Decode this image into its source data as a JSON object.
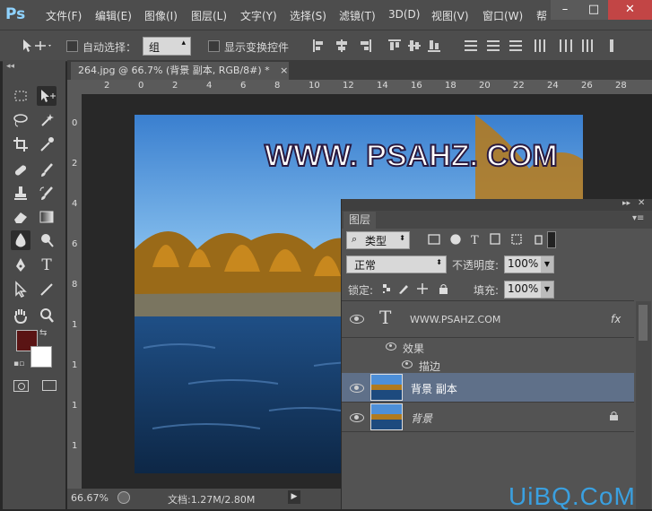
{
  "menubar": {
    "logo": "Ps",
    "items": [
      "文件(F)",
      "编辑(E)",
      "图像(I)",
      "图层(L)",
      "文字(Y)",
      "选择(S)",
      "滤镜(T)",
      "3D(D)",
      "视图(V)",
      "窗口(W)",
      "帮"
    ],
    "window_buttons": [
      "–",
      "□",
      "✕"
    ]
  },
  "options": {
    "auto_select_label": "自动选择：",
    "auto_select_value": "组",
    "show_transform_label": "显示变换控件"
  },
  "document": {
    "tab_title": "264.jpg @ 66.7% (背景 副本, RGB/8#) *",
    "tab_close": "×",
    "ruler_h": [
      "2",
      "0",
      "2",
      "4",
      "6",
      "8",
      "10",
      "12",
      "14",
      "16",
      "18",
      "20",
      "22",
      "24",
      "26",
      "28"
    ],
    "ruler_v": [
      "0",
      "2",
      "4",
      "6",
      "8",
      "1",
      "1",
      "1",
      "1"
    ],
    "watermark_text": "WWW. PSAHZ. COM"
  },
  "status": {
    "zoom": "66.67%",
    "doc_info": "文档:1.27M/2.80M"
  },
  "layers_panel": {
    "tab": "图层",
    "filter_kind": "类型",
    "blend_mode": "正常",
    "opacity_label": "不透明度:",
    "opacity_value": "100%",
    "lock_label": "锁定:",
    "fill_label": "填充:",
    "fill_value": "100%",
    "layers": [
      {
        "name": "WWW.PSAHZ.COM",
        "type": "text",
        "fx": "fx"
      },
      {
        "name": "效果",
        "type": "effect-group"
      },
      {
        "name": "描边",
        "type": "effect"
      },
      {
        "name": "背景 副本",
        "type": "image",
        "selected": true
      },
      {
        "name": "背景",
        "type": "image",
        "locked": true
      }
    ]
  },
  "site_watermark": "UiBQ.CoM",
  "colors": {
    "foreground": "#5a1414",
    "background": "#ffffff",
    "selected_layer": "#5f7089"
  }
}
